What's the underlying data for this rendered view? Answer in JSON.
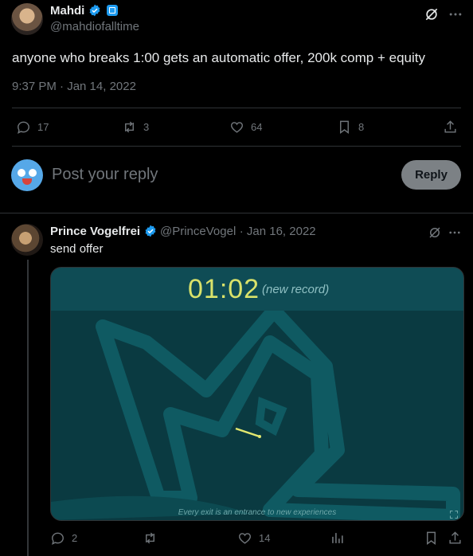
{
  "tweet": {
    "author_name": "Mahdi",
    "author_handle": "@mahdiofalltime",
    "text": "anyone who breaks 1:00 gets an automatic offer, 200k comp + equity",
    "timestamp": "9:37 PM · Jan 14, 2022",
    "actions": {
      "replies": "17",
      "reposts": "3",
      "likes": "64",
      "bookmarks": "8"
    }
  },
  "composer": {
    "placeholder": "Post your reply",
    "button_label": "Reply"
  },
  "reply": {
    "author_name": "Prince Vogelfrei",
    "author_handle": "@PrinceVogel",
    "date": "· Jan 16, 2022",
    "text": "send offer",
    "media": {
      "timer": "01:02",
      "record_label": "(new record)",
      "caption": "Every exit is an entrance to new experiences"
    },
    "actions": {
      "replies": "2",
      "likes": "14"
    }
  },
  "colors": {
    "accent": "#1d9bf0",
    "background": "#000000",
    "muted": "#71767b",
    "game_bg": "#0a3a41"
  }
}
